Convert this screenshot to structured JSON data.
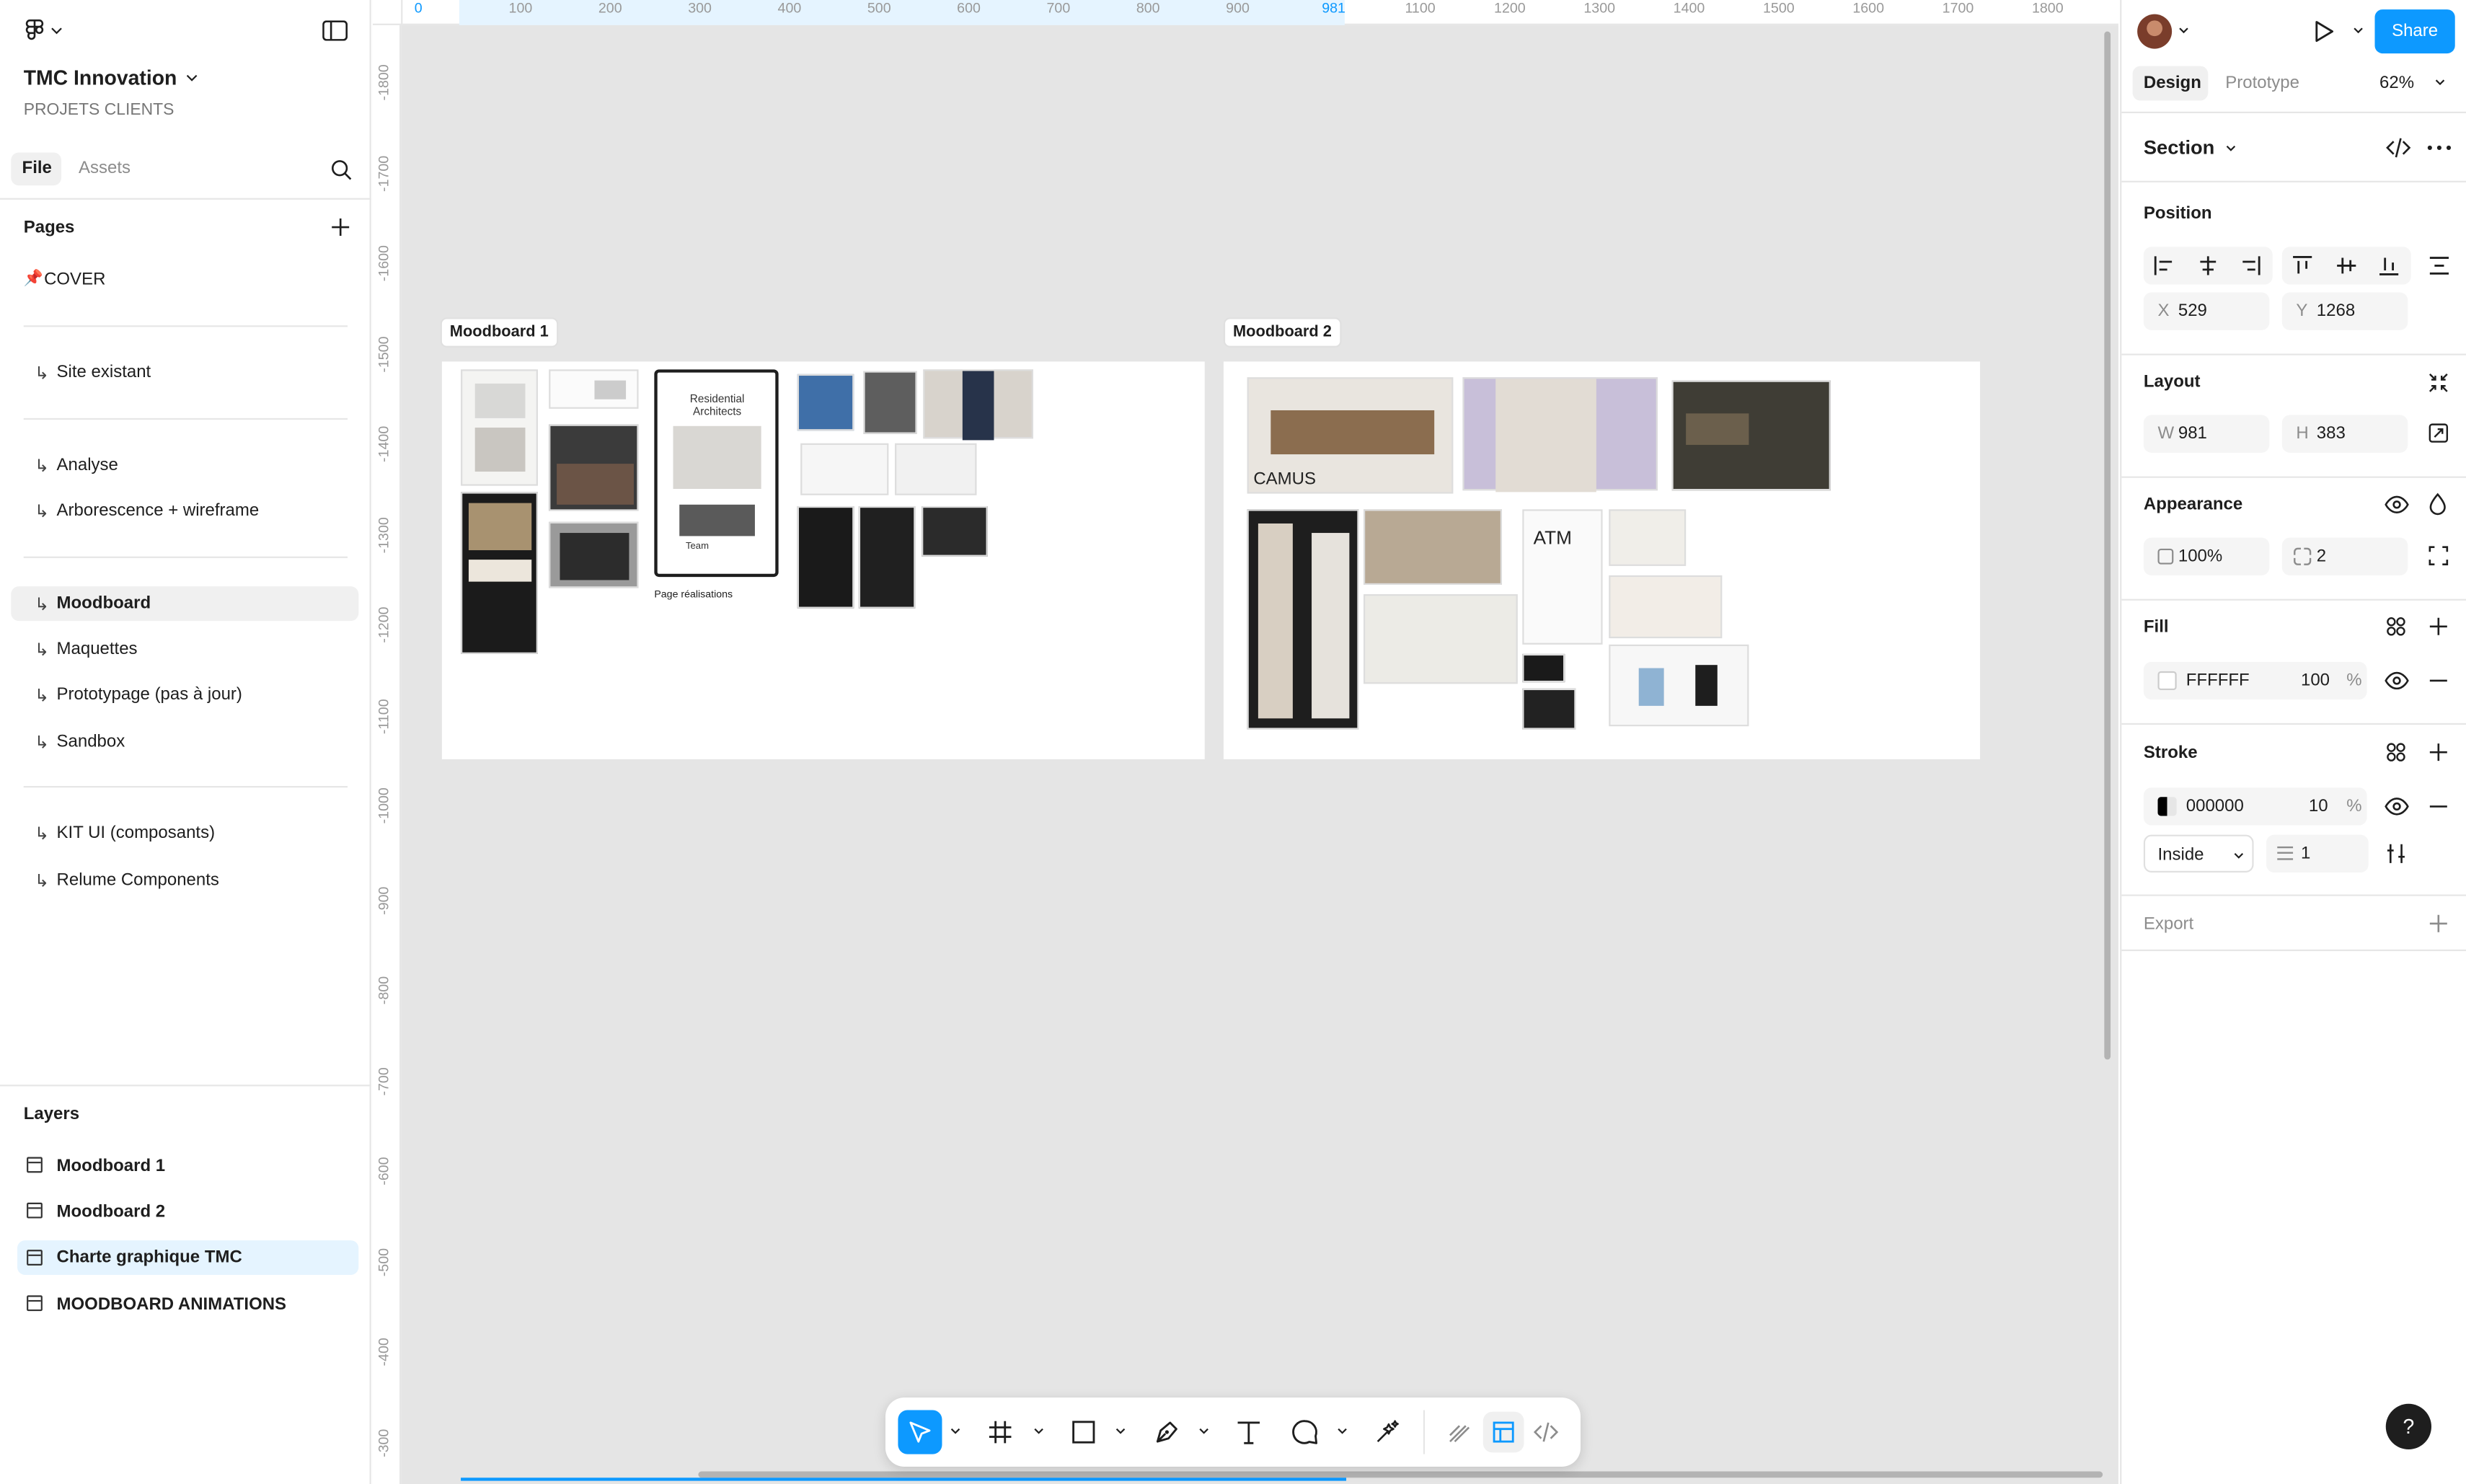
{
  "app": {
    "project_title": "TMC Innovation",
    "project_subtitle": "PROJETS CLIENTS"
  },
  "left_tabs": {
    "file": "File",
    "assets": "Assets"
  },
  "pages": {
    "heading": "Pages",
    "items": [
      {
        "label": "COVER",
        "prefix": "📌"
      },
      {
        "label": "Site existant",
        "prefix": "↳"
      },
      {
        "label": "Analyse",
        "prefix": "↳"
      },
      {
        "label": "Arborescence + wireframe",
        "prefix": "↳"
      },
      {
        "label": "Moodboard",
        "prefix": "↳",
        "selected": true
      },
      {
        "label": "Maquettes",
        "prefix": "↳"
      },
      {
        "label": "Prototypage (pas à jour)",
        "prefix": "↳"
      },
      {
        "label": "Sandbox",
        "prefix": "↳"
      },
      {
        "label": "KIT UI (composants)",
        "prefix": "↳"
      },
      {
        "label": "Relume Components",
        "prefix": "↳"
      }
    ]
  },
  "layers": {
    "heading": "Layers",
    "items": [
      {
        "label": "Moodboard 1"
      },
      {
        "label": "Moodboard 2"
      },
      {
        "label": "Charte graphique TMC",
        "selected": true
      },
      {
        "label": "MOODBOARD ANIMATIONS"
      }
    ]
  },
  "rulers": {
    "top": [
      "0",
      "100",
      "200",
      "300",
      "400",
      "500",
      "600",
      "700",
      "800",
      "900",
      "981",
      "1100",
      "1200",
      "1300",
      "1400",
      "1500",
      "1600",
      "1700",
      "1800"
    ],
    "left": [
      "-1800",
      "-1700",
      "-1600",
      "-1500",
      "-1400",
      "-1300",
      "-1200",
      "-1100",
      "-1000",
      "-900",
      "-800",
      "-700",
      "-600",
      "-500",
      "-400",
      "-300"
    ]
  },
  "canvas": {
    "section1_label": "Moodboard 1",
    "section2_label": "Moodboard 2",
    "thumb_caption_1": "Residential Architects",
    "thumb_caption_2": "Team",
    "thumb_caption_3": "Page réalisations",
    "thumb_caption_4": "CAMUS",
    "thumb_caption_5": "ATM"
  },
  "right": {
    "share": "Share",
    "tabs": {
      "design": "Design",
      "prototype": "Prototype"
    },
    "zoom": "62%",
    "selection_type": "Section",
    "position": {
      "label": "Position",
      "x_key": "X",
      "x": "529",
      "y_key": "Y",
      "y": "1268"
    },
    "layout": {
      "label": "Layout",
      "w_key": "W",
      "w": "981",
      "h_key": "H",
      "h": "383"
    },
    "appearance": {
      "label": "Appearance",
      "opacity": "100%",
      "radius": "2"
    },
    "fill": {
      "label": "Fill",
      "hex": "FFFFFF",
      "opacity": "100",
      "unit": "%"
    },
    "stroke": {
      "label": "Stroke",
      "hex": "000000",
      "opacity": "10",
      "unit": "%",
      "position": "Inside",
      "weight": "1"
    },
    "export": {
      "label": "Export"
    }
  },
  "colors": {
    "accent": "#0d99ff",
    "selected_bg": "#e5f4ff",
    "canvas_bg": "#e5e5e5"
  },
  "help": "?"
}
